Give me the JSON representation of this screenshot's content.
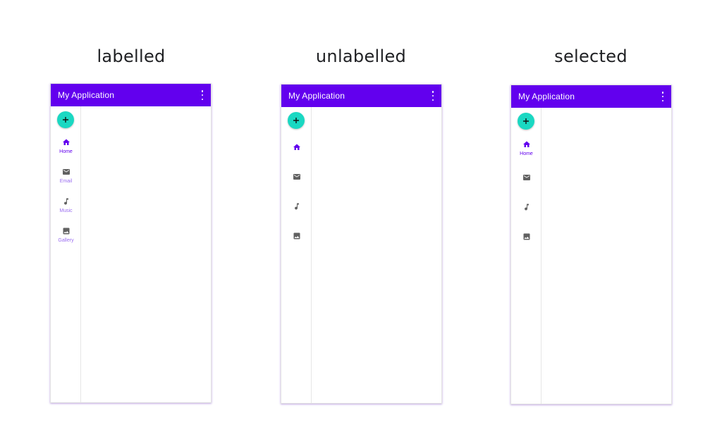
{
  "colors": {
    "primary": "#6200ee",
    "fab": "#1ad8c2",
    "icon_inactive": "#616161",
    "label_inactive": "#9a6df0"
  },
  "panels": [
    {
      "caption": "labelled",
      "app_title": "My Application",
      "fab_icon": "plus-icon",
      "items": [
        {
          "icon": "home-icon",
          "label": "Home",
          "selected": true
        },
        {
          "icon": "email-icon",
          "label": "Email",
          "selected": false
        },
        {
          "icon": "music-note-icon",
          "label": "Music",
          "selected": false
        },
        {
          "icon": "image-icon",
          "label": "Gallery",
          "selected": false
        }
      ]
    },
    {
      "caption": "unlabelled",
      "app_title": "My Application",
      "fab_icon": "plus-icon",
      "items": [
        {
          "icon": "home-icon",
          "selected": true
        },
        {
          "icon": "email-icon",
          "selected": false
        },
        {
          "icon": "music-note-icon",
          "selected": false
        },
        {
          "icon": "image-icon",
          "selected": false
        }
      ]
    },
    {
      "caption": "selected",
      "app_title": "My Application",
      "fab_icon": "plus-icon",
      "items": [
        {
          "icon": "home-icon",
          "label": "Home",
          "selected": true
        },
        {
          "icon": "email-icon",
          "selected": false
        },
        {
          "icon": "music-note-icon",
          "selected": false
        },
        {
          "icon": "image-icon",
          "selected": false
        }
      ]
    }
  ]
}
